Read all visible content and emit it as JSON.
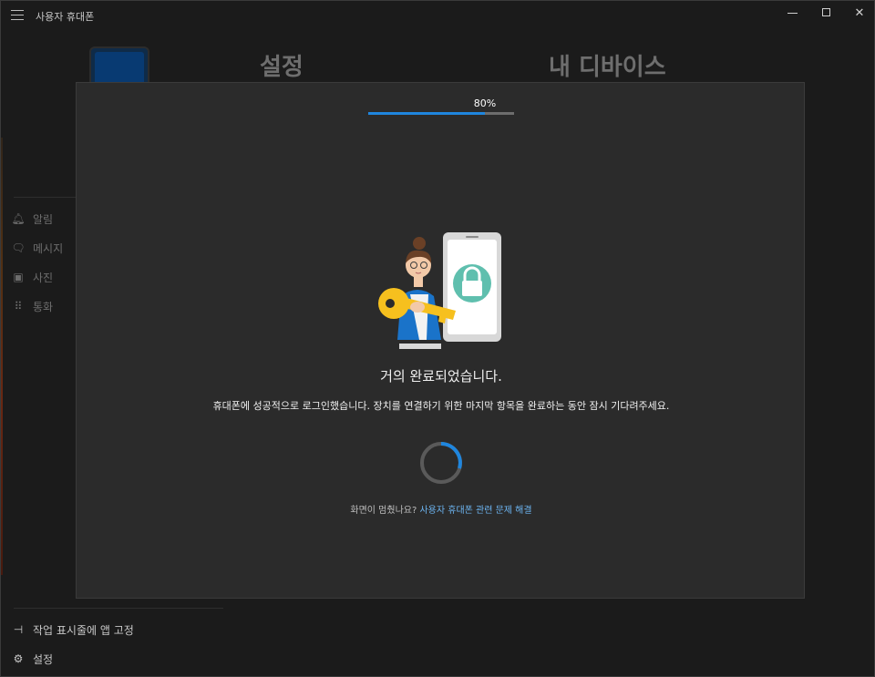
{
  "app": {
    "title": "사용자 휴대폰"
  },
  "window_controls": {
    "minimize": "minimize-icon",
    "maximize": "maximize-icon",
    "close": "✕"
  },
  "background": {
    "heading_settings": "설정",
    "heading_devices": "내 디바이스",
    "sidebar": {
      "items": [
        {
          "label": "알림",
          "icon": "bell-icon",
          "glyph": "🔔︎"
        },
        {
          "label": "메시지",
          "icon": "chat-icon",
          "glyph": "🗨︎"
        },
        {
          "label": "사진",
          "icon": "photo-icon",
          "glyph": "▣"
        },
        {
          "label": "통화",
          "icon": "dialpad-icon",
          "glyph": "⠿"
        }
      ],
      "bottom": [
        {
          "label": "작업 표시줄에 앱 고정",
          "icon": "pin-icon",
          "glyph": "⊣"
        },
        {
          "label": "설정",
          "icon": "gear-icon",
          "glyph": "⚙"
        }
      ]
    }
  },
  "modal": {
    "progress_text": "80%",
    "progress_value": 0.8,
    "heading": "거의 완료되었습니다.",
    "description": "휴대폰에 성공적으로 로그인했습니다. 장치를 연결하기 위한 마지막 항목을 완료하는 동안 잠시 기다려주세요.",
    "help_prefix": "화면이 멈췄나요?",
    "help_link": "사용자 휴대폰 관련 문제 해결"
  },
  "colors": {
    "accent": "#1f86de",
    "link": "#6cb4f0",
    "modal_bg": "#2b2b2b"
  }
}
